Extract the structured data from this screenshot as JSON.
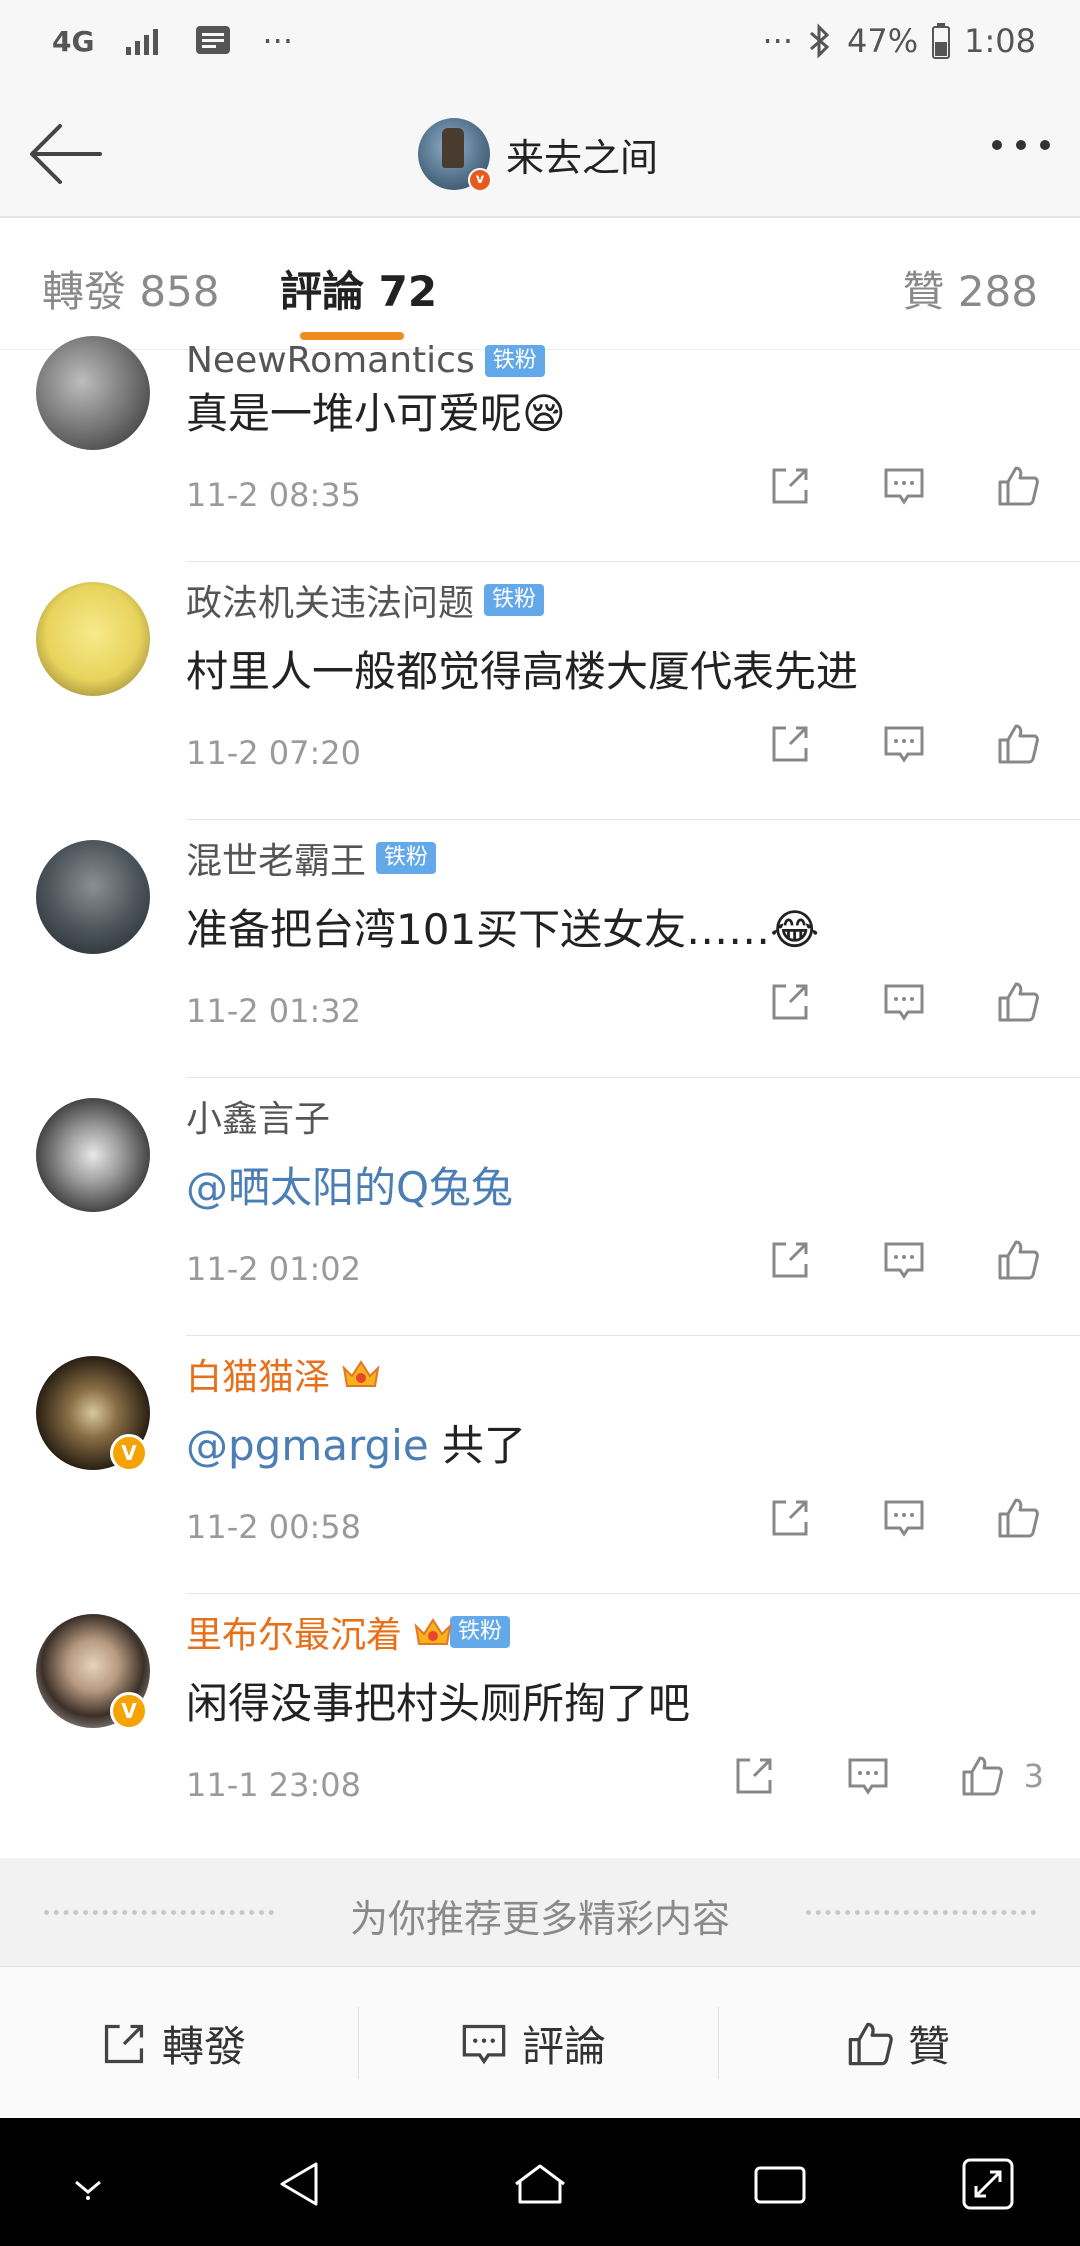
{
  "status_bar": {
    "network": "4G",
    "extra": "···",
    "dots": "···",
    "battery_percent": "47%",
    "time": "1:08"
  },
  "header": {
    "title": "来去之间",
    "icons": [
      "back-arrow-icon",
      "more-icon"
    ]
  },
  "tabs": [
    {
      "label": "轉發 858",
      "active": false
    },
    {
      "label": "評論 72",
      "active": true
    },
    {
      "label": "贊 288",
      "active": false
    }
  ],
  "accent_color": "#f08a1c",
  "comments": [
    {
      "name": "NeewRomantics",
      "badge": "铁粉",
      "text": "真是一堆小可爱呢😪",
      "time": "11-2 08:35"
    },
    {
      "name": "政法机关违法问题",
      "badge": "铁粉",
      "text": "村里人一般都觉得高楼大厦代表先进",
      "time": "11-2 07:20"
    },
    {
      "name": "混世老霸王",
      "badge": "铁粉",
      "text": "准备把台湾101买下送女友……😂",
      "time": "11-2 01:32"
    },
    {
      "name": "小鑫言子",
      "mention": "@晒太阳的Q兔兔",
      "time": "11-2 01:02"
    },
    {
      "name": "白猫猫泽",
      "mention": "@pgmargie",
      "text": " 共了",
      "time": "11-2 00:58",
      "verified": "V"
    },
    {
      "name": "里布尔最沉着",
      "badge": "铁粉",
      "text": "闲得没事把村头厕所掏了吧",
      "time": "11-1 23:08",
      "verified": "V",
      "likes": "3"
    }
  ],
  "recommend": {
    "label": "为你推荐更多精彩内容"
  },
  "toolbar": {
    "repost": "轉發",
    "comment": "評論",
    "like": "贊"
  }
}
